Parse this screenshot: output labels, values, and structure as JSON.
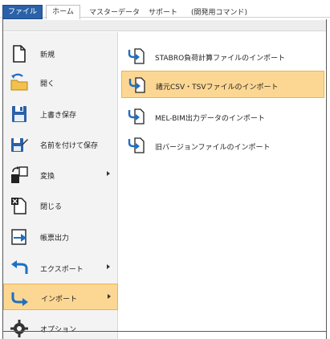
{
  "ribbon": {
    "tabs": {
      "file": "ファイル",
      "home": "ホーム",
      "master": "マスターデータ",
      "support": "サポート",
      "dev": "(開発用コマンド)"
    }
  },
  "nav": {
    "items": [
      {
        "label": "新規",
        "icon": "new-document-icon"
      },
      {
        "label": "開く",
        "icon": "open-folder-icon"
      },
      {
        "label": "上書き保存",
        "icon": "save-disk-icon"
      },
      {
        "label": "名前を付けて保存",
        "icon": "save-as-icon"
      },
      {
        "label": "変換",
        "icon": "convert-icon"
      },
      {
        "label": "閉じる",
        "icon": "close-document-icon"
      },
      {
        "label": "帳票出力",
        "icon": "report-output-icon"
      },
      {
        "label": "エクスポート",
        "icon": "export-arrow-icon"
      },
      {
        "label": "インポート",
        "icon": "import-arrow-icon"
      },
      {
        "label": "オプション",
        "icon": "options-gear-icon"
      }
    ],
    "selected_index": 8
  },
  "import": {
    "items": [
      {
        "label": "STABRO負荷計算ファイルのインポート",
        "icon": "import-file-icon"
      },
      {
        "label": "諸元CSV・TSVファイルのインポート",
        "icon": "import-file-icon"
      },
      {
        "label": "MEL-BIM出力データのインポート",
        "icon": "import-file-icon"
      },
      {
        "label": "旧バージョンファイルのインポート",
        "icon": "import-file-icon"
      }
    ],
    "selected_index": 1
  },
  "colors": {
    "accent_blue": "#2b61a8",
    "highlight": "#fcd793",
    "highlight_border": "#f0b24a",
    "nav_bg": "#f3f3f3"
  }
}
